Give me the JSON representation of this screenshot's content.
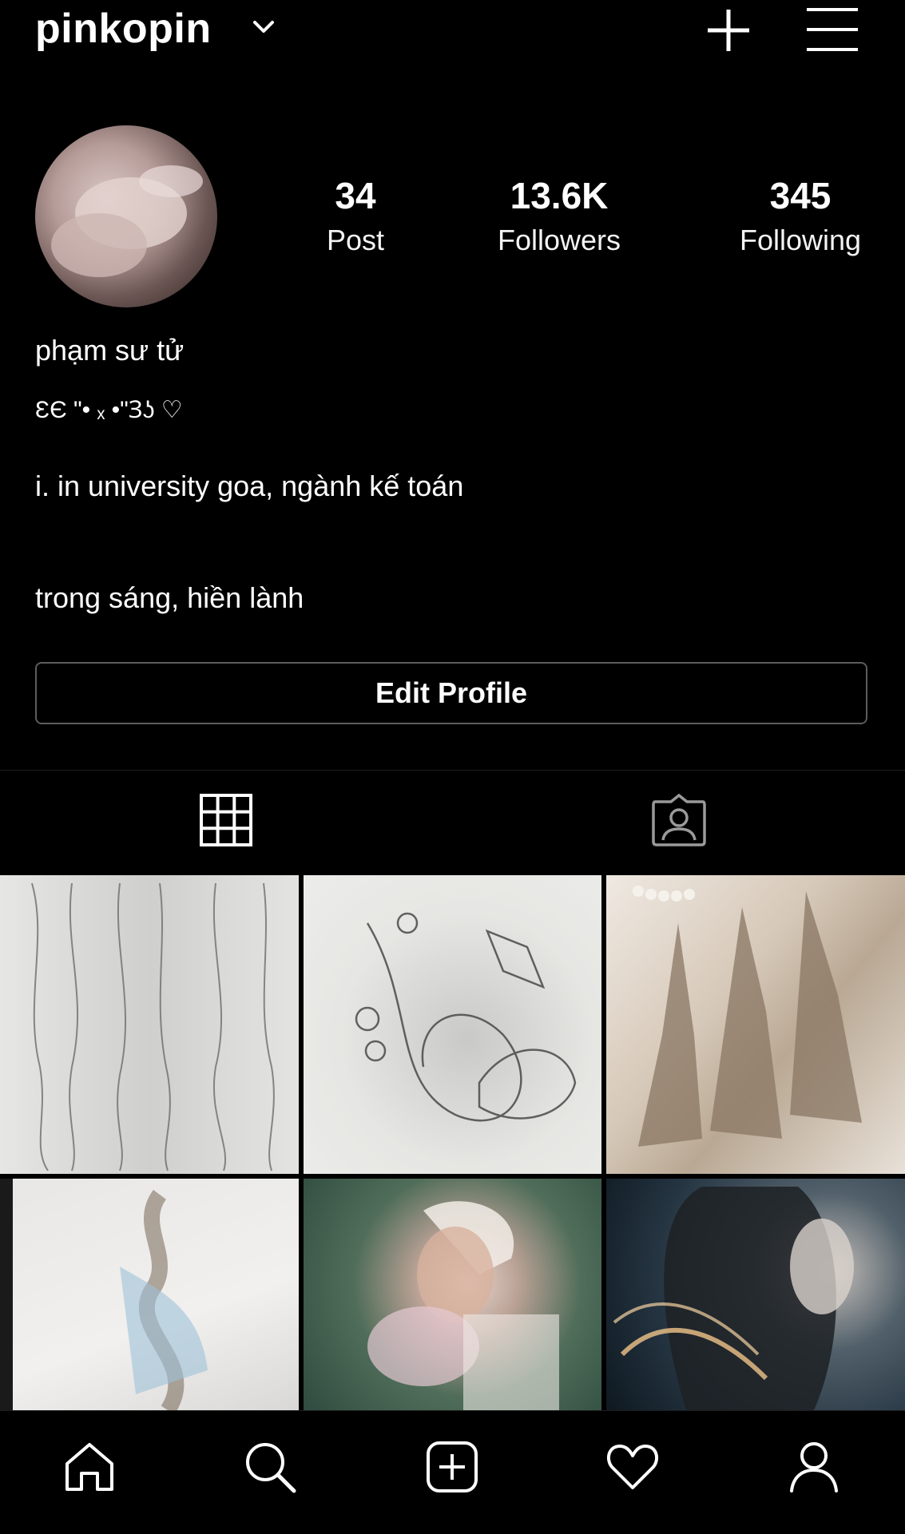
{
  "header": {
    "username": "pinkopin",
    "icons": [
      "chevron-down-icon",
      "plus-icon",
      "menu-icon"
    ]
  },
  "profile": {
    "avatar_icon": "avatar",
    "stats": [
      {
        "value": "34",
        "label": "Post"
      },
      {
        "value": "13.6K",
        "label": "Followers"
      },
      {
        "value": "345",
        "label": "Following"
      }
    ],
    "display_name": "phạm sư tử",
    "kaomoji": "ƐЄ \"• ₓ •\"Ɜʖ ♡",
    "bio_line_1": "i. in university goa, ngành kế toán",
    "bio_line_2": "trong sáng, hiền lành",
    "edit_button_label": "Edit Profile"
  },
  "tabs": [
    {
      "name": "posts-grid",
      "icon": "grid-icon"
    },
    {
      "name": "tagged",
      "icon": "tagged-person-icon"
    }
  ],
  "posts": [
    {
      "desc": "pencil sketch of three dresses"
    },
    {
      "desc": "pencil sketch whale and butterfly"
    },
    {
      "desc": "fashion illustrations with pearls"
    },
    {
      "desc": "watercolor fashion sketch"
    },
    {
      "desc": "painting of girl with flowers"
    },
    {
      "desc": "portrait with flowing hair"
    }
  ],
  "bottom_nav": [
    "home-icon",
    "search-icon",
    "add-post-icon",
    "heart-icon",
    "profile-icon"
  ],
  "colors": {
    "background": "#000000",
    "text": "#ffffff",
    "button_border": "#5d5d5d"
  }
}
